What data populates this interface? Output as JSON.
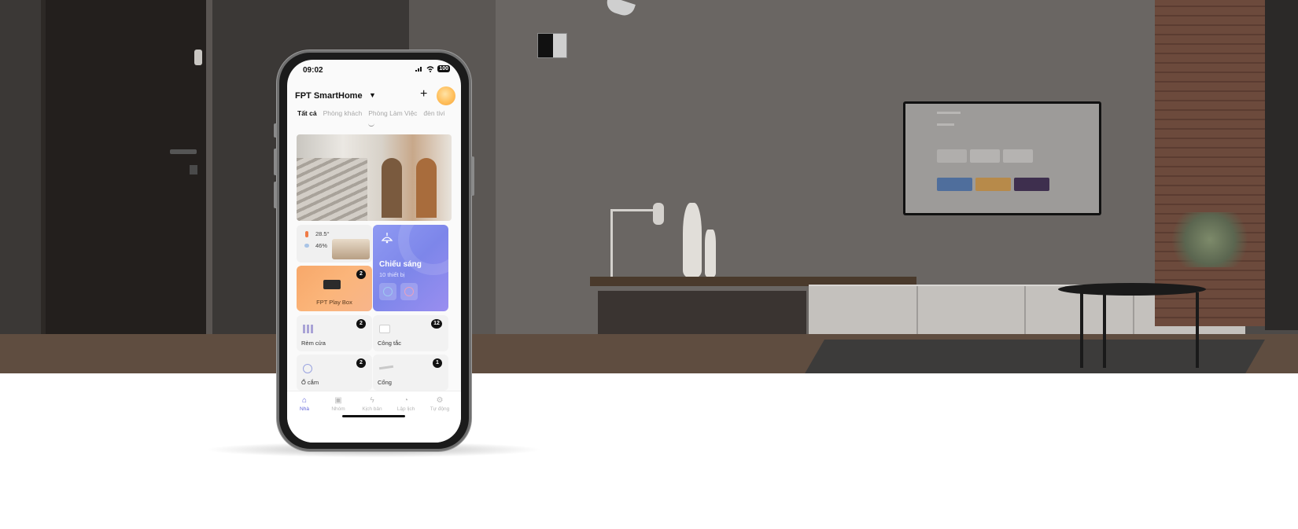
{
  "phone": {
    "status_time": "09:02",
    "battery": "100",
    "app_title": "FPT SmartHome",
    "caret": "▼",
    "add": "+"
  },
  "tabs": [
    {
      "label": "Tất cả",
      "active": true
    },
    {
      "label": "Phòng khách",
      "active": false
    },
    {
      "label": "Phòng Làm Việc",
      "active": false
    },
    {
      "label": "đèn tivi",
      "active": false
    }
  ],
  "weather": {
    "temperature": "28.5°",
    "humidity": "46%"
  },
  "lighting": {
    "title": "Chiếu sáng",
    "subtitle": "10 thiết bị"
  },
  "devices": [
    {
      "label": "FPT Play Box",
      "count": "2"
    },
    {
      "label": "Rèm cửa",
      "count": "2"
    },
    {
      "label": "Công tắc",
      "count": "12"
    },
    {
      "label": "Ổ cắm",
      "count": "2"
    },
    {
      "label": "Cổng",
      "count": "1"
    }
  ],
  "nav": [
    {
      "label": "Nhà",
      "icon": "home-icon",
      "active": true
    },
    {
      "label": "Nhóm",
      "icon": "group-icon",
      "active": false
    },
    {
      "label": "Kịch bản",
      "icon": "lightning-icon",
      "active": false
    },
    {
      "label": "Lập lịch",
      "icon": "clock-icon",
      "active": false
    },
    {
      "label": "Tự động",
      "icon": "automation-icon",
      "active": false
    }
  ],
  "colors": {
    "accent": "#5f62d8",
    "lighting_tile": "#8f9af2",
    "playbox_tile": "#f7a86a",
    "badge": "#111111"
  }
}
